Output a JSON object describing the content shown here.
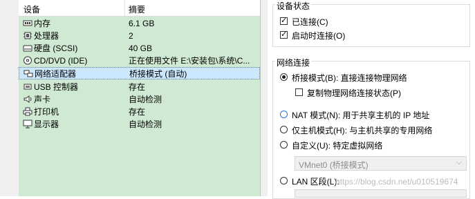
{
  "device_list": {
    "headers": {
      "device": "设备",
      "summary": "摘要"
    },
    "rows": [
      {
        "name": "内存",
        "summary": "6.1 GB",
        "icon": "memory-icon"
      },
      {
        "name": "处理器",
        "summary": "2",
        "icon": "processor-icon"
      },
      {
        "name": "硬盘 (SCSI)",
        "summary": "40 GB",
        "icon": "harddisk-icon"
      },
      {
        "name": "CD/DVD (IDE)",
        "summary": "正在使用文件 E:\\安装包\\系统\\C...",
        "icon": "cd-icon"
      },
      {
        "name": "网络适配器",
        "summary": "桥接模式 (自动)",
        "icon": "network-adapter-icon",
        "selected": true
      },
      {
        "name": "USB 控制器",
        "summary": "存在",
        "icon": "usb-icon"
      },
      {
        "name": "声卡",
        "summary": "自动检测",
        "icon": "sound-card-icon"
      },
      {
        "name": "打印机",
        "summary": "存在",
        "icon": "printer-icon"
      },
      {
        "name": "显示器",
        "summary": "自动检测",
        "icon": "display-icon"
      }
    ]
  },
  "device_status": {
    "title": "设备状态",
    "connected": {
      "label": "已连接(C)",
      "checked": true
    },
    "connect_on_start": {
      "label": "启动时连接(O)",
      "checked": true
    }
  },
  "network": {
    "title": "网络连接",
    "bridged": {
      "label": "桥接模式(B): 直接连接物理网络",
      "selected": true
    },
    "replicate": {
      "label": "复制物理网络连接状态(P)",
      "checked": false
    },
    "nat": {
      "label": "NAT 模式(N): 用于共享主机的 IP 地址"
    },
    "host_only": {
      "label": "仅主机模式(H): 与主机共享的专用网络"
    },
    "custom": {
      "label": "自定义(U): 特定虚拟网络"
    },
    "custom_value": "VMnet0 (桥接模式)",
    "lan": {
      "label": "LAN 区段(L):"
    }
  },
  "watermark": "https://blog.csdn.net/u010519674",
  "colors": {
    "list_bg": "#cfe9d2",
    "selected_bg": "#cce8ff"
  }
}
